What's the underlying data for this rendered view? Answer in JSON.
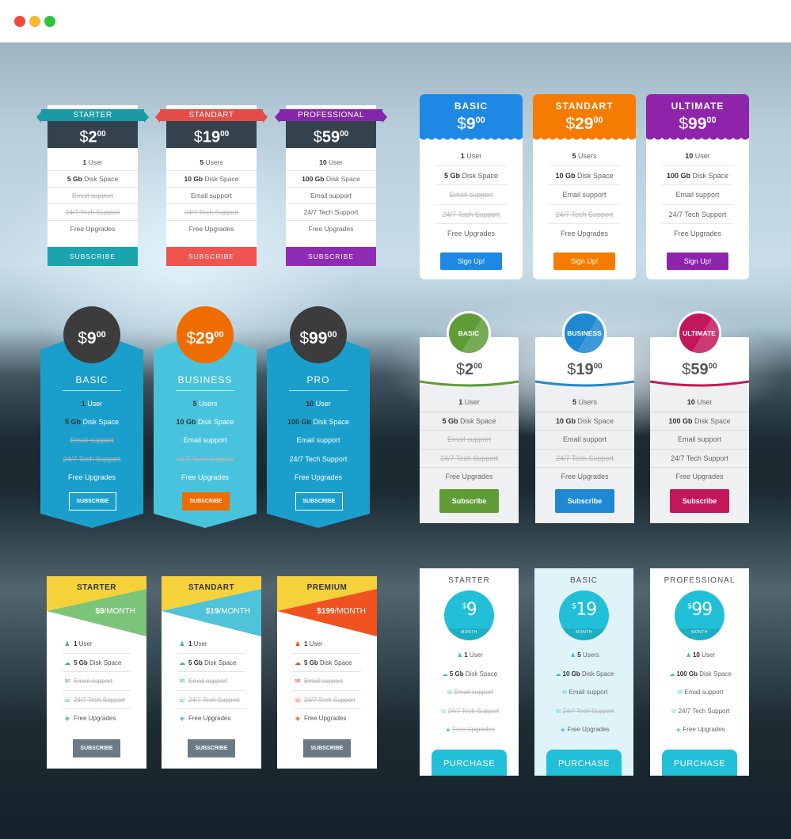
{
  "window": {
    "controls": [
      "close",
      "minimize",
      "maximize"
    ]
  },
  "table1": [
    {
      "name": "STARTER",
      "cur": "$",
      "price": "2",
      "cents": "00",
      "color": "#1ba3b0",
      "rib": "#199aa6",
      "btn": "SUBSCRIBE",
      "features": [
        {
          "b": "1",
          "t": " User",
          "s": false
        },
        {
          "b": "5 Gb",
          "t": " Disk Space",
          "s": false
        },
        {
          "b": "",
          "t": "Email support",
          "s": true
        },
        {
          "b": "",
          "t": "24/7 Tech Support",
          "s": true
        },
        {
          "b": "",
          "t": "Free Upgrades",
          "s": false
        }
      ]
    },
    {
      "name": "STANDART",
      "cur": "$",
      "price": "19",
      "cents": "00",
      "color": "#ef5450",
      "rib": "#e54b47",
      "btn": "SUBSCRIBE",
      "features": [
        {
          "b": "5",
          "t": " Users",
          "s": false
        },
        {
          "b": "10 Gb",
          "t": " Disk Space",
          "s": false
        },
        {
          "b": "",
          "t": "Email support",
          "s": false
        },
        {
          "b": "",
          "t": "24/7 Tech Support",
          "s": true
        },
        {
          "b": "",
          "t": "Free Upgrades",
          "s": false
        }
      ]
    },
    {
      "name": "PROFESSIONAL",
      "cur": "$",
      "price": "59",
      "cents": "00",
      "color": "#8e2bb4",
      "rib": "#8425aa",
      "btn": "SUBSCRIBE",
      "features": [
        {
          "b": "10",
          "t": " User",
          "s": false
        },
        {
          "b": "100 Gb",
          "t": " Disk Space",
          "s": false
        },
        {
          "b": "",
          "t": "Email support",
          "s": false
        },
        {
          "b": "",
          "t": "24/7 Tech Support",
          "s": false
        },
        {
          "b": "",
          "t": "Free Upgrades",
          "s": false
        }
      ]
    }
  ],
  "table2": [
    {
      "name": "BASIC",
      "cur": "$",
      "price": "9",
      "cents": "00",
      "color": "#1e88e5",
      "btn": "Sign Up!",
      "features": [
        {
          "b": "1",
          "t": " User",
          "s": false
        },
        {
          "b": "5 Gb",
          "t": " Disk Space",
          "s": false
        },
        {
          "b": "",
          "t": "Email support",
          "s": true
        },
        {
          "b": "",
          "t": "24/7 Tech Support",
          "s": true
        },
        {
          "b": "",
          "t": "Free Upgrades",
          "s": false
        }
      ]
    },
    {
      "name": "STANDART",
      "cur": "$",
      "price": "29",
      "cents": "00",
      "color": "#f57c00",
      "btn": "Sign Up!",
      "features": [
        {
          "b": "5",
          "t": " Users",
          "s": false
        },
        {
          "b": "10 Gb",
          "t": " Disk Space",
          "s": false
        },
        {
          "b": "",
          "t": "Email support",
          "s": false
        },
        {
          "b": "",
          "t": "24/7 Tech Support",
          "s": true
        },
        {
          "b": "",
          "t": "Free Upgrades",
          "s": false
        }
      ]
    },
    {
      "name": "ULTIMATE",
      "cur": "$",
      "price": "99",
      "cents": "00",
      "color": "#8e24aa",
      "btn": "Sign Up!",
      "features": [
        {
          "b": "10",
          "t": " User",
          "s": false
        },
        {
          "b": "100 Gb",
          "t": " Disk Space",
          "s": false
        },
        {
          "b": "",
          "t": "Email support",
          "s": false
        },
        {
          "b": "",
          "t": "24/7 Tech Support",
          "s": false
        },
        {
          "b": "",
          "t": "Free Upgrades",
          "s": false
        }
      ]
    }
  ],
  "table3": [
    {
      "name": "BASIC",
      "cur": "$",
      "price": "9",
      "cents": "00",
      "color": "#1a9fcc",
      "circle": "#3c3c3c",
      "btn": "SUBSCRIBE",
      "btnStyle": "outline",
      "features": [
        {
          "b": "1",
          "t": " User",
          "s": false
        },
        {
          "b": "5 Gb",
          "t": " Disk Space",
          "s": false
        },
        {
          "b": "",
          "t": "Email support",
          "s": true
        },
        {
          "b": "",
          "t": "24/7 Tech Support",
          "s": true
        },
        {
          "b": "",
          "t": "Free Upgrades",
          "s": false
        }
      ]
    },
    {
      "name": "BUSINESS",
      "cur": "$",
      "price": "29",
      "cents": "00",
      "color": "#48c3de",
      "circle": "#ef6c00",
      "btn": "SUBSCRIBE",
      "btnStyle": "filled",
      "features": [
        {
          "b": "5",
          "t": " Users",
          "s": false
        },
        {
          "b": "10 Gb",
          "t": " Disk Space",
          "s": false
        },
        {
          "b": "",
          "t": "Email support",
          "s": false
        },
        {
          "b": "",
          "t": "24/7 Tech Support",
          "s": true
        },
        {
          "b": "",
          "t": "Free Upgrades",
          "s": false
        }
      ]
    },
    {
      "name": "PRO",
      "cur": "$",
      "price": "99",
      "cents": "00",
      "color": "#1a9fcc",
      "circle": "#3c3c3c",
      "btn": "SUBSCRIBE",
      "btnStyle": "outline",
      "features": [
        {
          "b": "10",
          "t": " User",
          "s": false
        },
        {
          "b": "100 Gb",
          "t": " Disk Space",
          "s": false
        },
        {
          "b": "",
          "t": "Email support",
          "s": false
        },
        {
          "b": "",
          "t": "24/7 Tech Support",
          "s": false
        },
        {
          "b": "",
          "t": "Free Upgrades",
          "s": false
        }
      ]
    }
  ],
  "table4": [
    {
      "name": "BASIC",
      "cur": "$",
      "price": "2",
      "cents": "00",
      "color": "#5f9c35",
      "btn": "Subscribe",
      "features": [
        {
          "b": "1",
          "t": " User",
          "s": false
        },
        {
          "b": "5 Gb",
          "t": " Disk Space",
          "s": false
        },
        {
          "b": "",
          "t": "Email support",
          "s": true
        },
        {
          "b": "",
          "t": "24/7 Tech Support",
          "s": true
        },
        {
          "b": "",
          "t": "Free Upgrades",
          "s": false
        }
      ]
    },
    {
      "name": "BUSINESS",
      "cur": "$",
      "price": "19",
      "cents": "00",
      "color": "#1e88d2",
      "btn": "Subscribe",
      "features": [
        {
          "b": "5",
          "t": " Users",
          "s": false
        },
        {
          "b": "10 Gb",
          "t": " Disk Space",
          "s": false
        },
        {
          "b": "",
          "t": "Email support",
          "s": false
        },
        {
          "b": "",
          "t": "24/7 Tech Support",
          "s": true
        },
        {
          "b": "",
          "t": "Free Upgrades",
          "s": false
        }
      ]
    },
    {
      "name": "ULTIMATE",
      "cur": "$",
      "price": "59",
      "cents": "00",
      "color": "#c2185b",
      "btn": "Subscribe",
      "features": [
        {
          "b": "10",
          "t": " User",
          "s": false
        },
        {
          "b": "100 Gb",
          "t": " Disk Space",
          "s": false
        },
        {
          "b": "",
          "t": "Email support",
          "s": false
        },
        {
          "b": "",
          "t": "24/7 Tech Support",
          "s": false
        },
        {
          "b": "",
          "t": "Free Upgrades",
          "s": false
        }
      ]
    }
  ],
  "table5": [
    {
      "name": "STARTER",
      "price": "$9",
      "period": "/MONTH",
      "top": "#f6d23a",
      "diag": "#7cc47a",
      "iconColor": "#4aa89a",
      "btn": "SUBSCRIBE",
      "features": [
        {
          "icon": "user-icon",
          "g": "&#9823;",
          "b": "1",
          "t": " User",
          "s": false
        },
        {
          "icon": "cloud-icon",
          "g": "&#9729;",
          "b": "5 Gb",
          "t": " Disk Space",
          "s": false
        },
        {
          "icon": "mail-icon",
          "g": "&#9993;",
          "b": "",
          "t": "Email support",
          "s": true
        },
        {
          "icon": "headset-icon",
          "g": "&#9743;",
          "b": "",
          "t": "24/7 Tech Support",
          "s": true
        },
        {
          "icon": "gift-icon",
          "g": "&#9672;",
          "b": "",
          "t": "Free Upgrades",
          "s": false
        }
      ]
    },
    {
      "name": "STANDART",
      "price": "$19",
      "period": "/MONTH",
      "top": "#f6d23a",
      "diag": "#4ec3d9",
      "iconColor": "#3aaec5",
      "btn": "SUBSCRIBE",
      "features": [
        {
          "icon": "user-icon",
          "g": "&#9823;",
          "b": "1",
          "t": " User",
          "s": false
        },
        {
          "icon": "cloud-icon",
          "g": "&#9729;",
          "b": "5 Gb",
          "t": " Disk Space",
          "s": false
        },
        {
          "icon": "mail-icon",
          "g": "&#9993;",
          "b": "",
          "t": "Email support",
          "s": true
        },
        {
          "icon": "headset-icon",
          "g": "&#9743;",
          "b": "",
          "t": "24/7 Tech Support",
          "s": true
        },
        {
          "icon": "gift-icon",
          "g": "&#9672;",
          "b": "",
          "t": "Free Upgrades",
          "s": false
        }
      ]
    },
    {
      "name": "PREMIUM",
      "price": "$199",
      "period": "/MONTH",
      "top": "#f6d23a",
      "diag": "#f0531f",
      "iconColor": "#e64a19",
      "btn": "SUBSCRIBE",
      "features": [
        {
          "icon": "user-icon",
          "g": "&#9823;",
          "b": "1",
          "t": " User",
          "s": false
        },
        {
          "icon": "cloud-icon",
          "g": "&#9729;",
          "b": "5 Gb",
          "t": " Disk Space",
          "s": false
        },
        {
          "icon": "mail-icon",
          "g": "&#9993;",
          "b": "",
          "t": "Email support",
          "s": true
        },
        {
          "icon": "headset-icon",
          "g": "&#9743;",
          "b": "",
          "t": "24/7 Tech Support",
          "s": true
        },
        {
          "icon": "gift-icon",
          "g": "&#9672;",
          "b": "",
          "t": "Free Upgrades",
          "s": false
        }
      ]
    }
  ],
  "table6": [
    {
      "name": "STARTER",
      "cur": "$",
      "price": "9",
      "period": "MONTH",
      "bg": "#ffffff",
      "circle": "#22c0d8",
      "btn": "PURCHASE",
      "features": [
        {
          "icon": "user-icon",
          "g": "&#9823;",
          "b": "1",
          "t": " User",
          "s": false
        },
        {
          "icon": "cloud-icon",
          "g": "&#9729;",
          "b": "5 Gb",
          "t": " Disk Space",
          "s": false
        },
        {
          "icon": "mail-icon",
          "g": "&#9993;",
          "b": "",
          "t": "Email support",
          "s": true
        },
        {
          "icon": "headset-icon",
          "g": "&#9743;",
          "b": "",
          "t": "24/7 Tech Support",
          "s": true
        },
        {
          "icon": "gift-icon",
          "g": "&#9672;",
          "b": "",
          "t": "Free Upgrades",
          "s": true
        }
      ]
    },
    {
      "name": "BASIC",
      "cur": "$",
      "price": "19",
      "period": "MONTH",
      "bg": "#dff3f8",
      "circle": "#22c0d8",
      "btn": "PURCHASE",
      "features": [
        {
          "icon": "user-icon",
          "g": "&#9823;",
          "b": "5",
          "t": " Users",
          "s": false
        },
        {
          "icon": "cloud-icon",
          "g": "&#9729;",
          "b": "10 Gb",
          "t": " Disk Space",
          "s": false
        },
        {
          "icon": "mail-icon",
          "g": "&#9993;",
          "b": "",
          "t": "Email support",
          "s": false
        },
        {
          "icon": "headset-icon",
          "g": "&#9743;",
          "b": "",
          "t": "24/7 Tech Support",
          "s": true
        },
        {
          "icon": "gift-icon",
          "g": "&#9672;",
          "b": "",
          "t": "Free Upgrades",
          "s": false
        }
      ]
    },
    {
      "name": "PROFESSIONAL",
      "cur": "$",
      "price": "99",
      "period": "MONTH",
      "bg": "#ffffff",
      "circle": "#22c0d8",
      "btn": "PURCHASE",
      "features": [
        {
          "icon": "user-icon",
          "g": "&#9823;",
          "b": "10",
          "t": " User",
          "s": false
        },
        {
          "icon": "cloud-icon",
          "g": "&#9729;",
          "b": "100 Gb",
          "t": " Disk Space",
          "s": false
        },
        {
          "icon": "mail-icon",
          "g": "&#9993;",
          "b": "",
          "t": "Email support",
          "s": false
        },
        {
          "icon": "headset-icon",
          "g": "&#9743;",
          "b": "",
          "t": "24/7 Tech Support",
          "s": false
        },
        {
          "icon": "gift-icon",
          "g": "&#9672;",
          "b": "",
          "t": "Free Upgrades",
          "s": false
        }
      ]
    }
  ]
}
